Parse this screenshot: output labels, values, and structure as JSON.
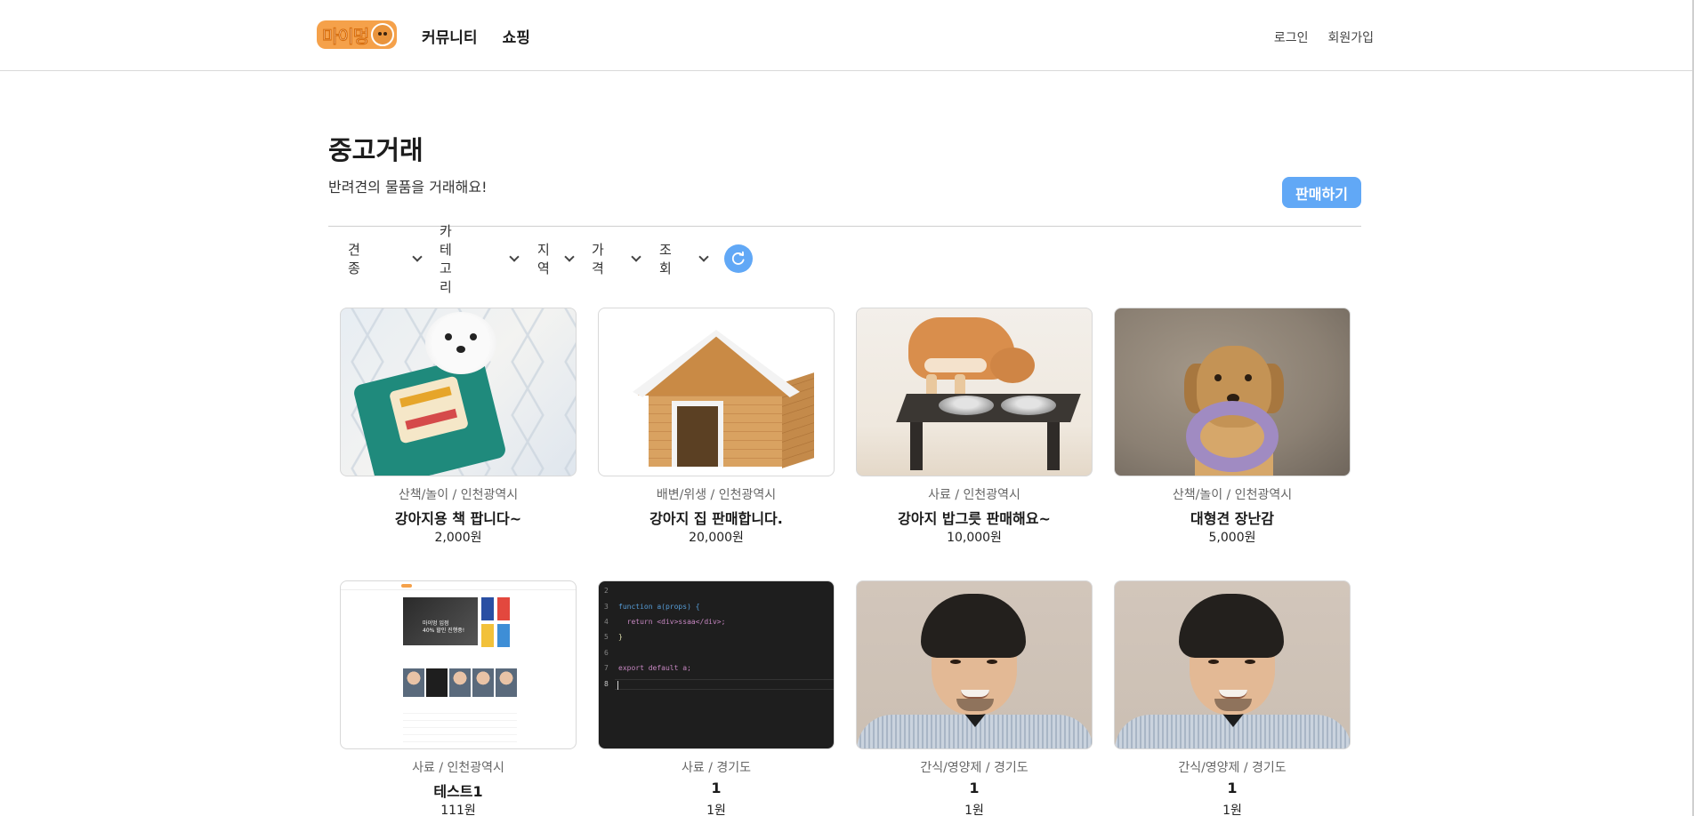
{
  "header": {
    "logo_text": "마이멍",
    "nav": [
      "커뮤니티",
      "쇼핑"
    ],
    "login": "로그인",
    "signup": "회원가입"
  },
  "page": {
    "title": "중고거래",
    "subtitle": "반려견의 물품을 거래해요!",
    "sell_button": "판매하기"
  },
  "filters": [
    {
      "label": "견종",
      "icon": "chevron-down-icon"
    },
    {
      "label": "카테고리",
      "icon": "chevron-down-icon"
    },
    {
      "label": "지역",
      "icon": "chevron-down-icon"
    },
    {
      "label": "가격",
      "icon": "chevron-down-icon"
    },
    {
      "label": "조회",
      "icon": "chevron-down-icon"
    }
  ],
  "refresh_icon": "refresh-icon",
  "products": [
    {
      "meta": "산책/놀이 / 인천광역시",
      "title": "강아지용 책 팝니다~",
      "price": "2,000원",
      "image": "maltese-with-book-toy"
    },
    {
      "meta": "배변/위생 / 인천광역시",
      "title": "강아지 집 판매합니다.",
      "price": "20,000원",
      "image": "wooden-doghouse"
    },
    {
      "meta": "사료 / 인천광역시",
      "title": "강아지 밥그릇 판매해요~",
      "price": "10,000원",
      "image": "shiba-eating-from-feeder"
    },
    {
      "meta": "산책/놀이 / 인천광역시",
      "title": "대형견 장난감",
      "price": "5,000원",
      "image": "golden-retriever-with-ring-toy"
    },
    {
      "meta": "사료 / 인천광역시",
      "title": "테스트1",
      "price": "111원",
      "image": "website-screenshot"
    },
    {
      "meta": "사료 / 경기도",
      "title": "1",
      "price": "1원",
      "image": "code-editor-screenshot"
    },
    {
      "meta": "간식/영양제 / 경기도",
      "title": "1",
      "price": "1원",
      "image": "man-portrait"
    },
    {
      "meta": "간식/영양제 / 경기도",
      "title": "1",
      "price": "1원",
      "image": "man-portrait"
    }
  ],
  "code_snippet": {
    "lines": [
      {
        "n": "2",
        "text": ""
      },
      {
        "n": "3",
        "text": "function a(props) {"
      },
      {
        "n": "4",
        "text": "  return <div>ssaa</div>;"
      },
      {
        "n": "5",
        "text": "}"
      },
      {
        "n": "6",
        "text": ""
      },
      {
        "n": "7",
        "text": "export default a;"
      },
      {
        "n": "8",
        "text": ""
      }
    ]
  },
  "screenshot_banner": [
    "마이멍 입점",
    "40% 할인 진행중!"
  ],
  "colors": {
    "accent": "#61a8f6",
    "logo": "#f5a14a",
    "divider": "#cfcfcf"
  }
}
